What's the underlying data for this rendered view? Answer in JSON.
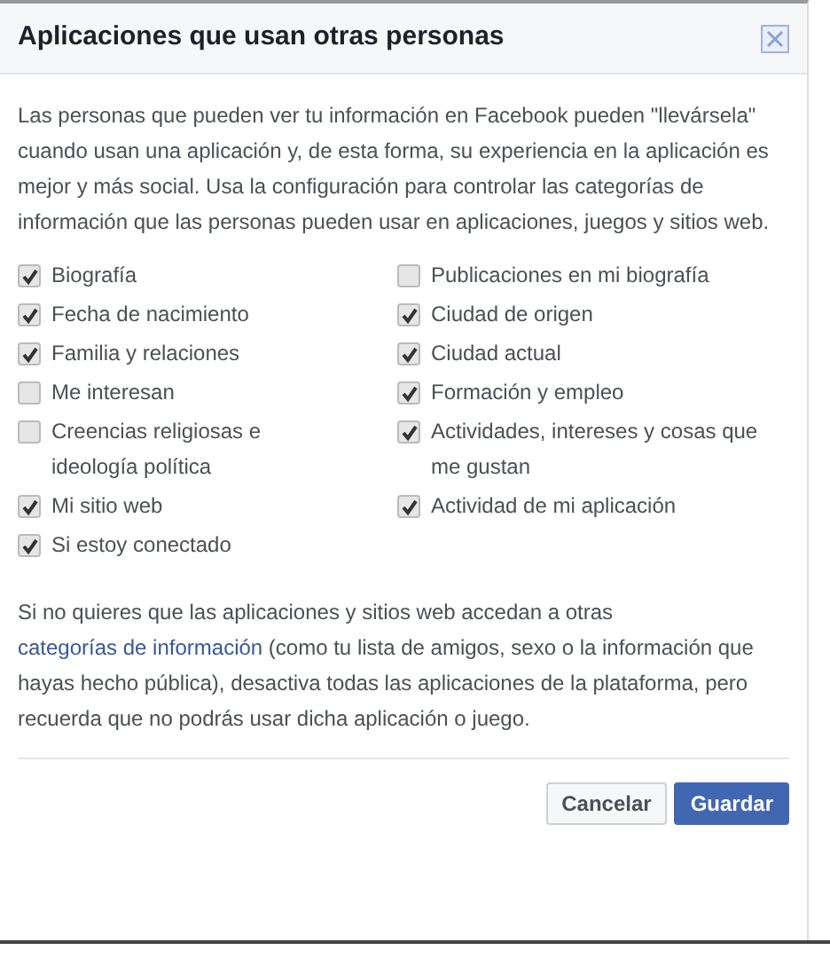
{
  "dialog": {
    "title": "Aplicaciones que usan otras personas",
    "intro": "Las personas que pueden ver tu información en Facebook pueden \"llevársela\" cuando usan una aplicación y, de esta forma, su experiencia en la aplicación es mejor y más social. Usa la configuración para controlar las categorías de información que las personas pueden usar en aplicaciones, juegos y sitios web.",
    "columns": [
      [
        {
          "label": "Biografía",
          "checked": true
        },
        {
          "label": "Fecha de nacimiento",
          "checked": true
        },
        {
          "label": "Familia y relaciones",
          "checked": true
        },
        {
          "label": "Me interesan",
          "checked": false
        },
        {
          "label": "Creencias religiosas e ideología política",
          "checked": false
        },
        {
          "label": "Mi sitio web",
          "checked": true
        },
        {
          "label": "Si estoy conectado",
          "checked": true
        }
      ],
      [
        {
          "label": "Publicaciones en mi biografía",
          "checked": false
        },
        {
          "label": "Ciudad de origen",
          "checked": true
        },
        {
          "label": "Ciudad actual",
          "checked": true
        },
        {
          "label": "Formación y empleo",
          "checked": true
        },
        {
          "label": "Actividades, intereses y cosas que me gustan",
          "checked": true
        },
        {
          "label": "Actividad de mi aplicación",
          "checked": true
        }
      ]
    ],
    "note_before": "Si no quieres que las aplicaciones y sitios web accedan a otras",
    "note_link": "categorías de información",
    "note_after": "(como tu lista de amigos, sexo o la información que hayas hecho pública), desactiva todas las aplicaciones de la plataforma, pero recuerda que no podrás usar dicha aplicación o juego.",
    "buttons": [
      {
        "label": "Cancelar",
        "kind": "secondary"
      },
      {
        "label": "Guardar",
        "kind": "primary"
      }
    ]
  }
}
